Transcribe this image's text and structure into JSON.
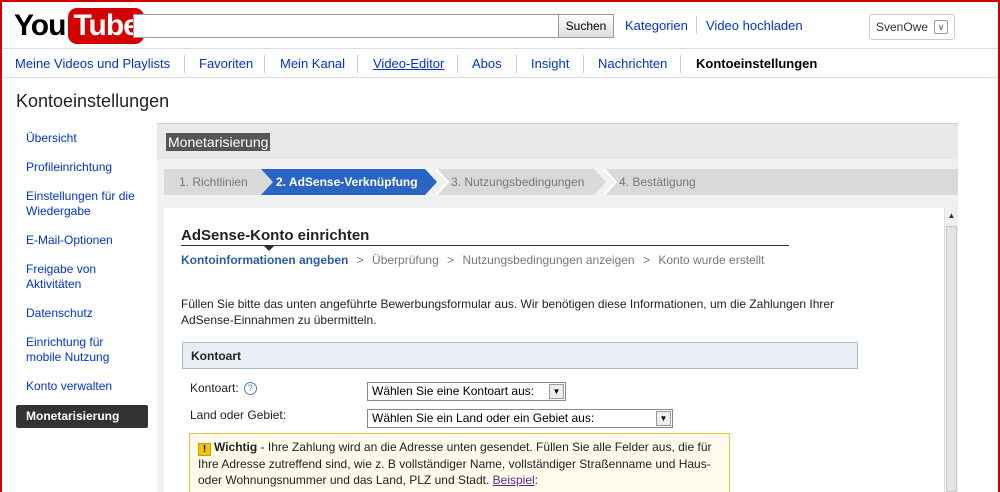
{
  "header": {
    "logo_you": "You",
    "logo_tube": "Tube",
    "search_placeholder": "",
    "search_button": "Suchen",
    "link_categories": "Kategorien",
    "link_upload": "Video hochladen",
    "username": "SvenOwe",
    "menu_icon": "chevron-down-icon"
  },
  "nav": {
    "items": [
      {
        "label": "Meine Videos und Playlists"
      },
      {
        "label": "Favoriten"
      },
      {
        "label": "Mein Kanal"
      },
      {
        "label": "Video-Editor"
      },
      {
        "label": "Abos"
      },
      {
        "label": "Insight"
      },
      {
        "label": "Nachrichten"
      },
      {
        "label": "Kontoeinstellungen"
      }
    ],
    "active": "Kontoeinstellungen"
  },
  "page_title": "Kontoeinstellungen",
  "sidebar": {
    "items": [
      {
        "label": "Übersicht"
      },
      {
        "label": "Profileinrichtung"
      },
      {
        "label": "Einstellungen für die Wiedergabe"
      },
      {
        "label": "E-Mail-Optionen"
      },
      {
        "label": "Freigabe von Aktivitäten"
      },
      {
        "label": "Datenschutz"
      },
      {
        "label": "Einrichtung für mobile Nutzung"
      },
      {
        "label": "Konto verwalten"
      },
      {
        "label": "Monetarisierung"
      }
    ],
    "active": "Monetarisierung"
  },
  "main": {
    "title": "Monetarisierung",
    "steps": [
      {
        "label": "1. Richtlinien"
      },
      {
        "label": "2. AdSense-Verknüpfung"
      },
      {
        "label": "3. Nutzungsbedingungen"
      },
      {
        "label": "4. Bestätigung"
      }
    ],
    "active_step": 2,
    "colors": {
      "step_active": "#2a65c4",
      "step_inactive": "#d9d9d9",
      "warn_bg": "#fffbea"
    }
  },
  "adsense": {
    "title": "AdSense-Konto einrichten",
    "substeps": [
      "Kontoinformationen angeben",
      "Überprüfung",
      "Nutzungsbedingungen anzeigen",
      "Konto wurde erstellt"
    ],
    "separator": ">",
    "intro": "Füllen Sie bitte das unten angeführte Bewerbungsformular aus. Wir benötigen diese Informationen, um die Zahlungen Ihrer AdSense-Einnahmen zu übermitteln.",
    "section_title": "Kontoart",
    "fields": {
      "account_type_label": "Kontoart:",
      "help_glyph": "?",
      "account_type_value": "Wählen Sie eine Kontoart aus:",
      "country_label": "Land oder Gebiet:",
      "country_value": "Wählen Sie ein Land oder ein Gebiet aus:"
    },
    "warning": {
      "glyph": "!",
      "title": "Wichtig",
      "text": " - Ihre Zahlung wird an die Adresse unten gesendet. Füllen Sie alle Felder aus, die für Ihre Adresse zutreffend sind, wie z. B vollständiger Name, vollständiger Straßenname und Haus- oder Wohnungsnummer und das Land, PLZ und Stadt. ",
      "link": "Beispiel",
      "after": ":"
    }
  }
}
